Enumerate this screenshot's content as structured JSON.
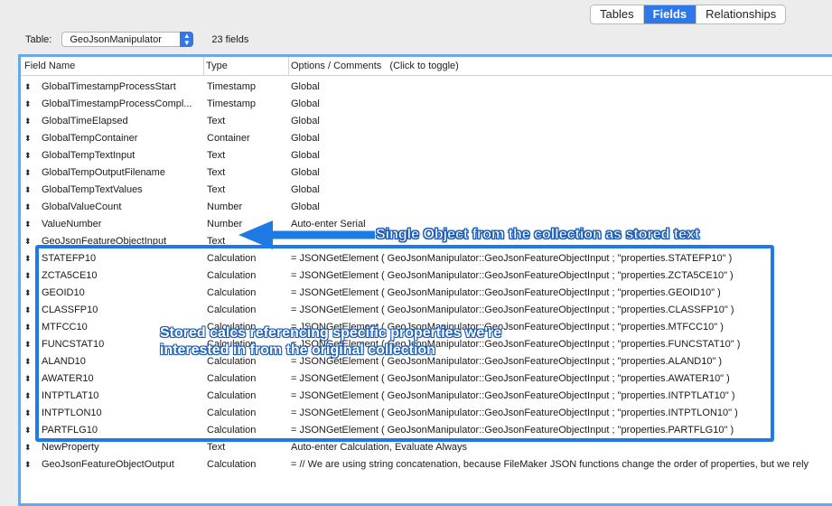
{
  "tabs": [
    {
      "label": "Tables",
      "active": false
    },
    {
      "label": "Fields",
      "active": true
    },
    {
      "label": "Relationships",
      "active": false
    }
  ],
  "table_selector": {
    "label": "Table:",
    "value": "GeoJsonManipulator",
    "count": "23 fields"
  },
  "columns": {
    "name": "Field Name",
    "type": "Type",
    "options": "Options / Comments   (Click to toggle)"
  },
  "fields": [
    {
      "name": "GlobalTimestampProcessStart",
      "type": "Timestamp",
      "options": "Global"
    },
    {
      "name": "GlobalTimestampProcessCompl...",
      "type": "Timestamp",
      "options": "Global"
    },
    {
      "name": "GlobalTimeElapsed",
      "type": "Text",
      "options": "Global"
    },
    {
      "name": "GlobalTempContainer",
      "type": "Container",
      "options": "Global"
    },
    {
      "name": "GlobalTempTextInput",
      "type": "Text",
      "options": "Global"
    },
    {
      "name": "GlobalTempOutputFilename",
      "type": "Text",
      "options": "Global"
    },
    {
      "name": "GlobalTempTextValues",
      "type": "Text",
      "options": "Global"
    },
    {
      "name": "GlobalValueCount",
      "type": "Number",
      "options": "Global"
    },
    {
      "name": "ValueNumber",
      "type": "Number",
      "options": "Auto-enter Serial"
    },
    {
      "name": "GeoJsonFeatureObjectInput",
      "type": "Text",
      "options": ""
    },
    {
      "name": "STATEFP10",
      "type": "Calculation",
      "options": "= JSONGetElement ( GeoJsonManipulator::GeoJsonFeatureObjectInput ; \"properties.STATEFP10\" )"
    },
    {
      "name": "ZCTA5CE10",
      "type": "Calculation",
      "options": "= JSONGetElement ( GeoJsonManipulator::GeoJsonFeatureObjectInput ; \"properties.ZCTA5CE10\" )"
    },
    {
      "name": "GEOID10",
      "type": "Calculation",
      "options": "= JSONGetElement ( GeoJsonManipulator::GeoJsonFeatureObjectInput ; \"properties.GEOID10\" )"
    },
    {
      "name": "CLASSFP10",
      "type": "Calculation",
      "options": "= JSONGetElement ( GeoJsonManipulator::GeoJsonFeatureObjectInput ; \"properties.CLASSFP10\" )"
    },
    {
      "name": "MTFCC10",
      "type": "Calculation",
      "options": "= JSONGetElement ( GeoJsonManipulator::GeoJsonFeatureObjectInput ; \"properties.MTFCC10\" )"
    },
    {
      "name": "FUNCSTAT10",
      "type": "Calculation",
      "options": "= JSONGetElement ( GeoJsonManipulator::GeoJsonFeatureObjectInput ; \"properties.FUNCSTAT10\" )"
    },
    {
      "name": "ALAND10",
      "type": "Calculation",
      "options": "= JSONGetElement ( GeoJsonManipulator::GeoJsonFeatureObjectInput ; \"properties.ALAND10\" )"
    },
    {
      "name": "AWATER10",
      "type": "Calculation",
      "options": "= JSONGetElement ( GeoJsonManipulator::GeoJsonFeatureObjectInput ; \"properties.AWATER10\" )"
    },
    {
      "name": "INTPTLAT10",
      "type": "Calculation",
      "options": "= JSONGetElement ( GeoJsonManipulator::GeoJsonFeatureObjectInput ; \"properties.INTPTLAT10\" )"
    },
    {
      "name": "INTPTLON10",
      "type": "Calculation",
      "options": "= JSONGetElement ( GeoJsonManipulator::GeoJsonFeatureObjectInput ; \"properties.INTPTLON10\" )"
    },
    {
      "name": "PARTFLG10",
      "type": "Calculation",
      "options": "= JSONGetElement ( GeoJsonManipulator::GeoJsonFeatureObjectInput ; \"properties.PARTFLG10\" )"
    },
    {
      "name": "NewProperty",
      "type": "Text",
      "options": "Auto-enter Calculation, Evaluate Always"
    },
    {
      "name": "GeoJsonFeatureObjectOutput",
      "type": "Calculation",
      "options": "= // We are using string concatenation, because FileMaker JSON functions change the order of properties, but we rely"
    }
  ],
  "annotations": {
    "callout_single": "Single Object from the collection as stored text",
    "callout_stored_line1": "Stored calcs referencing specific properties we're",
    "callout_stored_line2": "interested in from the original collection",
    "accent_color": "#1e7be6"
  },
  "icons": {
    "row_handle": "drag-handle-icon",
    "select_arrow": "updown-chevron-icon"
  }
}
